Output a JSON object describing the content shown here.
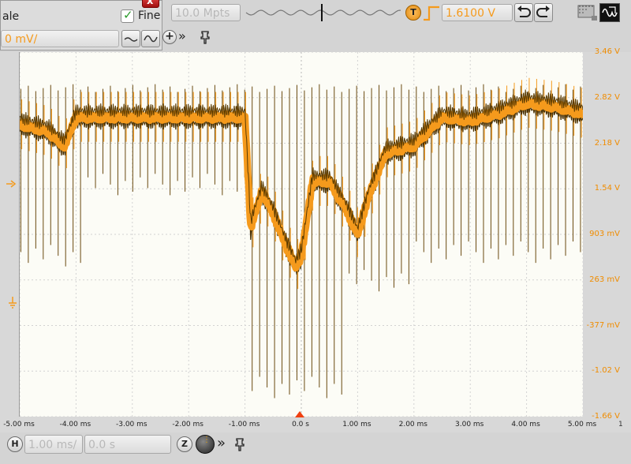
{
  "header": {
    "scale_label": "ale",
    "fine_label": "Fine",
    "voltage_value": "0 mV/",
    "memory_depth": "10.0 Mpts",
    "trigger_badge": "T",
    "trigger_level": "1.6100 V"
  },
  "footer": {
    "h_badge": "H",
    "time_scale": "1.00 ms/",
    "time_offset": "0.0 s",
    "zoom_badge": "Z"
  },
  "axis": {
    "y_labels": [
      "3.46 V",
      "2.82 V",
      "2.18 V",
      "1.54 V",
      "903 mV",
      "263 mV",
      "-377 mV",
      "-1.02 V",
      "-1.66 V"
    ],
    "x_labels": [
      "-5.00 ms",
      "-4.00 ms",
      "-3.00 ms",
      "-2.00 ms",
      "-1.00 ms",
      "0.0 s",
      "1.00 ms",
      "2.00 ms",
      "3.00 ms",
      "4.00 ms",
      "5.00 ms"
    ],
    "corner_label": "1"
  },
  "colors": {
    "trace": "#f59a1c",
    "trace_dark": "#4a3000",
    "axis_text": "#f08c00"
  },
  "chart_data": {
    "type": "line",
    "x_unit": "ms",
    "x": [
      -5.0,
      -4.5,
      -4.3,
      -4.2,
      -4.0,
      -3.0,
      -2.0,
      -1.0,
      -0.9,
      -0.7,
      -0.5,
      -0.3,
      -0.1,
      0.0,
      0.2,
      0.5,
      0.8,
      1.0,
      1.2,
      1.5,
      2.0,
      2.5,
      3.0,
      3.5,
      4.0,
      4.5,
      5.0
    ],
    "y": [
      2.45,
      2.35,
      2.2,
      2.15,
      2.55,
      2.55,
      2.55,
      2.55,
      1.0,
      1.5,
      1.2,
      0.8,
      0.45,
      0.6,
      1.65,
      1.65,
      1.25,
      0.9,
      1.45,
      2.05,
      2.15,
      2.55,
      2.5,
      2.6,
      2.75,
      2.7,
      2.6
    ],
    "spikes": {
      "upper_v": 2.95,
      "lower_v_regions": [
        {
          "from": -5.0,
          "to": -3.8,
          "v": 0.55
        },
        {
          "from": -3.8,
          "to": -1.0,
          "v": 1.55
        },
        {
          "from": -1.0,
          "to": 0.8,
          "v": -1.3
        },
        {
          "from": 0.8,
          "to": 2.0,
          "v": 0.2
        },
        {
          "from": 2.0,
          "to": 5.0,
          "v": 0.6
        }
      ]
    },
    "xlim": [
      -5.0,
      5.0
    ],
    "ylim": [
      -1.66,
      3.46
    ],
    "ylabel": "",
    "xlabel": "",
    "grid": true
  }
}
